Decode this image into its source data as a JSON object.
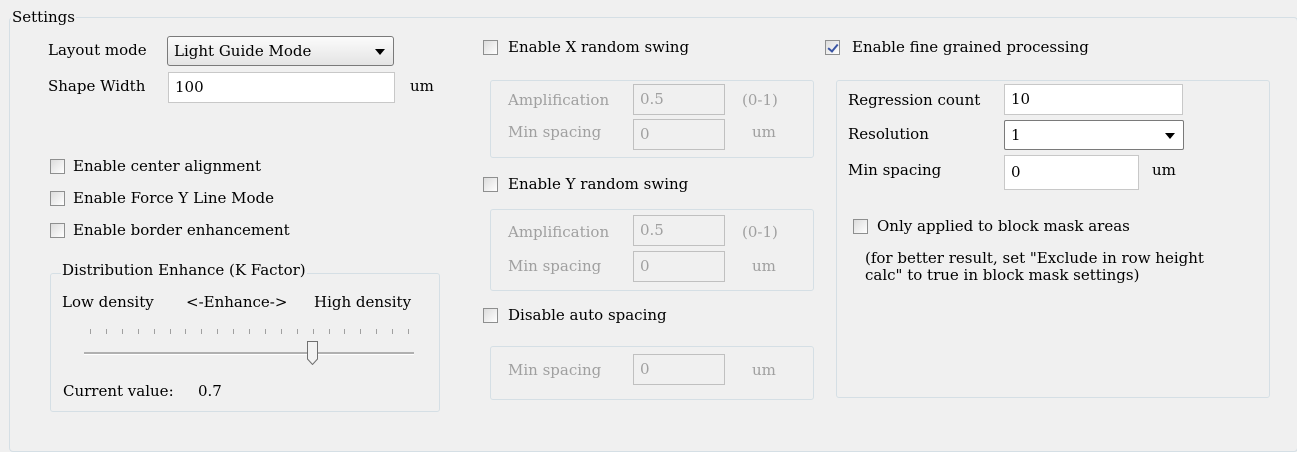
{
  "settings_group": {
    "title": "Settings"
  },
  "layout_mode": {
    "label": "Layout mode",
    "value": "Light Guide Mode"
  },
  "shape_width": {
    "label": "Shape Width",
    "value": "100",
    "unit": "um"
  },
  "options": {
    "center_alignment": {
      "label": "Enable center alignment",
      "checked": false
    },
    "force_y_line": {
      "label": "Enable Force Y Line Mode",
      "checked": false
    },
    "border_enhancement": {
      "label": "Enable border enhancement",
      "checked": false
    }
  },
  "distribution": {
    "title": "Distribution Enhance (K Factor)",
    "low_label": "Low density",
    "mid_label": "<-Enhance->",
    "high_label": "High density",
    "current_label": "Current value:",
    "current_value": "0.7",
    "slider_fraction": 0.7
  },
  "x_swing": {
    "label": "Enable X random swing",
    "checked": false,
    "amplification_label": "Amplification",
    "amplification_value": "0.5",
    "amplification_range": "(0-1)",
    "min_spacing_label": "Min spacing",
    "min_spacing_value": "0",
    "unit": "um"
  },
  "y_swing": {
    "label": "Enable Y random swing",
    "checked": false,
    "amplification_label": "Amplification",
    "amplification_value": "0.5",
    "amplification_range": "(0-1)",
    "min_spacing_label": "Min spacing",
    "min_spacing_value": "0",
    "unit": "um"
  },
  "auto_spacing": {
    "label": "Disable auto spacing",
    "checked": false,
    "min_spacing_label": "Min spacing",
    "min_spacing_value": "0",
    "unit": "um"
  },
  "fine_grained": {
    "label": "Enable fine grained processing",
    "checked": true,
    "regression_label": "Regression count",
    "regression_value": "10",
    "resolution_label": "Resolution",
    "resolution_value": "1",
    "min_spacing_label": "Min spacing",
    "min_spacing_value": "0",
    "unit": "um",
    "block_mask_label": "Only applied to block mask areas",
    "block_mask_checked": false,
    "note_line1": "(for better result, set \"Exclude in row height",
    "note_line2": "calc\" to true in block mask settings)"
  },
  "colors": {
    "check_mark": "#3a55a4",
    "disabled_text": "#a0a0a0",
    "group_border": "#d5dfe5"
  }
}
